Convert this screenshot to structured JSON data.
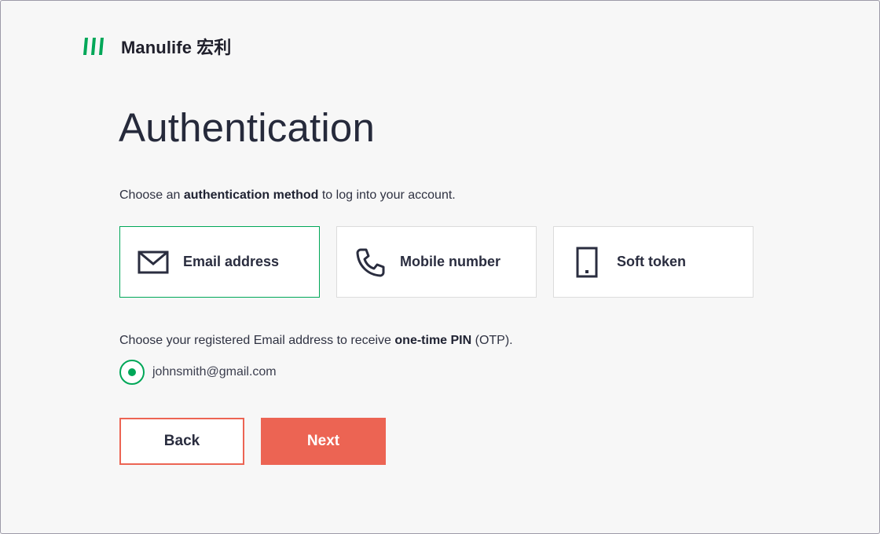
{
  "brand": {
    "name": "Manulife 宏利",
    "accent_color": "#00a758",
    "logo_icon": "manulife-stripes-logo"
  },
  "page": {
    "title": "Authentication"
  },
  "intro": {
    "prefix": "Choose an ",
    "bold": "authentication method",
    "suffix": " to log into your account."
  },
  "methods": [
    {
      "label": "Email address",
      "icon": "envelope-icon",
      "selected": true
    },
    {
      "label": "Mobile number",
      "icon": "phone-icon",
      "selected": false
    },
    {
      "label": "Soft token",
      "icon": "mobile-device-icon",
      "selected": false
    }
  ],
  "otp_prompt": {
    "prefix": "Choose your registered Email address to receive ",
    "bold": "one-time PIN",
    "suffix": " (OTP)."
  },
  "email_option": {
    "value": "johnsmith@gmail.com",
    "selected": true
  },
  "actions": {
    "back_label": "Back",
    "next_label": "Next",
    "primary_color": "#ec6453"
  }
}
